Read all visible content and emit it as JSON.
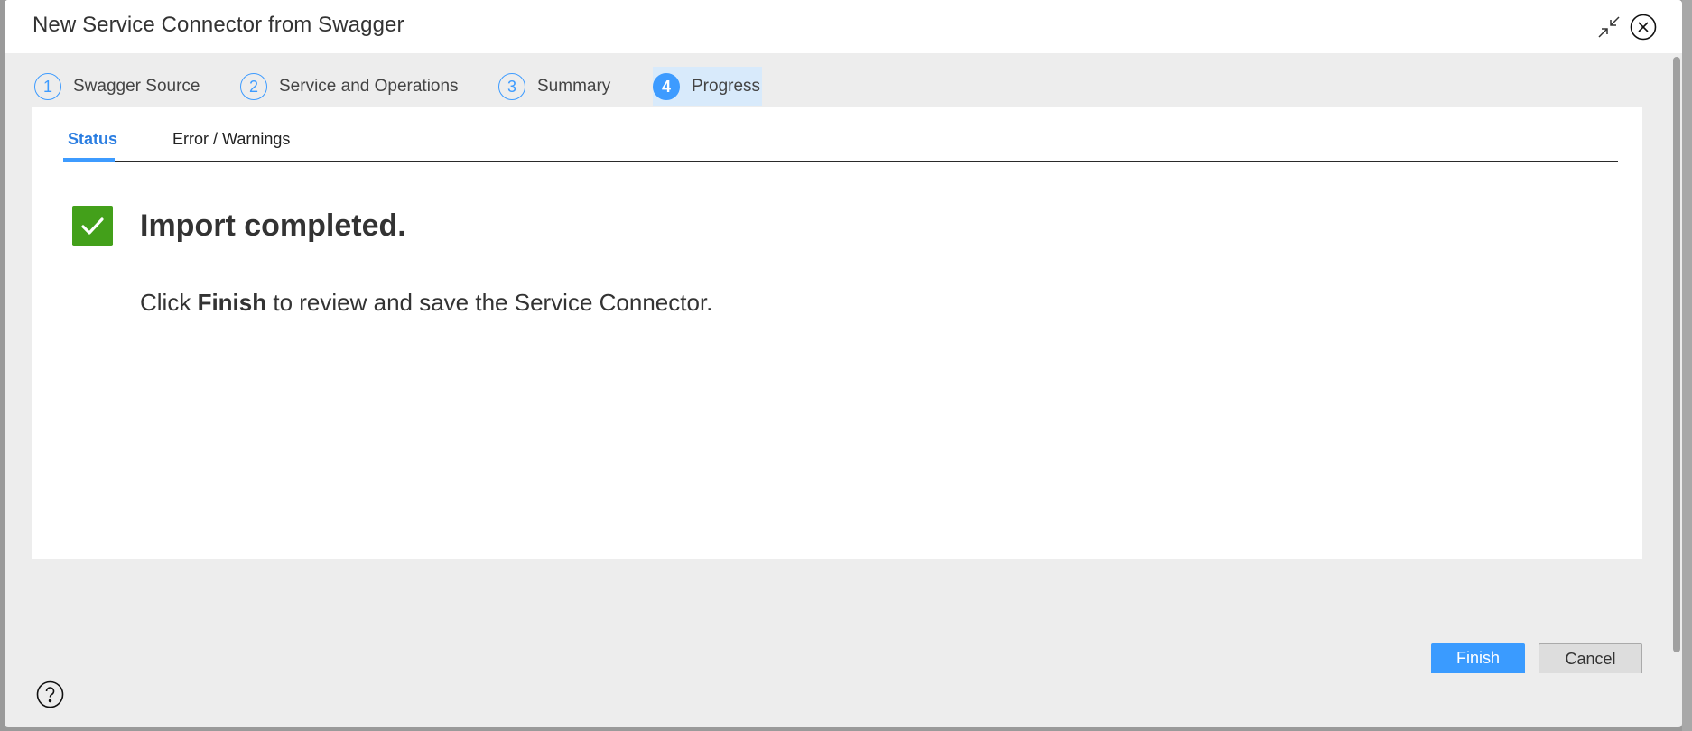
{
  "dialog": {
    "title": "New Service Connector from Swagger",
    "icons": {
      "collapse": "collapse-icon",
      "close": "close-icon",
      "help": "help-icon"
    }
  },
  "steps": [
    {
      "number": "1",
      "label": "Swagger Source",
      "active": false
    },
    {
      "number": "2",
      "label": "Service and Operations",
      "active": false
    },
    {
      "number": "3",
      "label": "Summary",
      "active": false
    },
    {
      "number": "4",
      "label": "Progress",
      "active": true
    }
  ],
  "tabs": [
    {
      "label": "Status",
      "active": true
    },
    {
      "label": "Error / Warnings",
      "active": false
    }
  ],
  "status": {
    "icon": "check-icon",
    "title": "Import completed.",
    "instruction_prefix": "Click ",
    "instruction_bold": "Finish",
    "instruction_suffix": " to review and save the Service Connector."
  },
  "buttons": {
    "finish": "Finish",
    "cancel": "Cancel"
  },
  "colors": {
    "accent": "#3d9bff",
    "success": "#43a01a",
    "active_step_bg": "#d8eafb",
    "active_tab_text": "#2a7de1"
  }
}
